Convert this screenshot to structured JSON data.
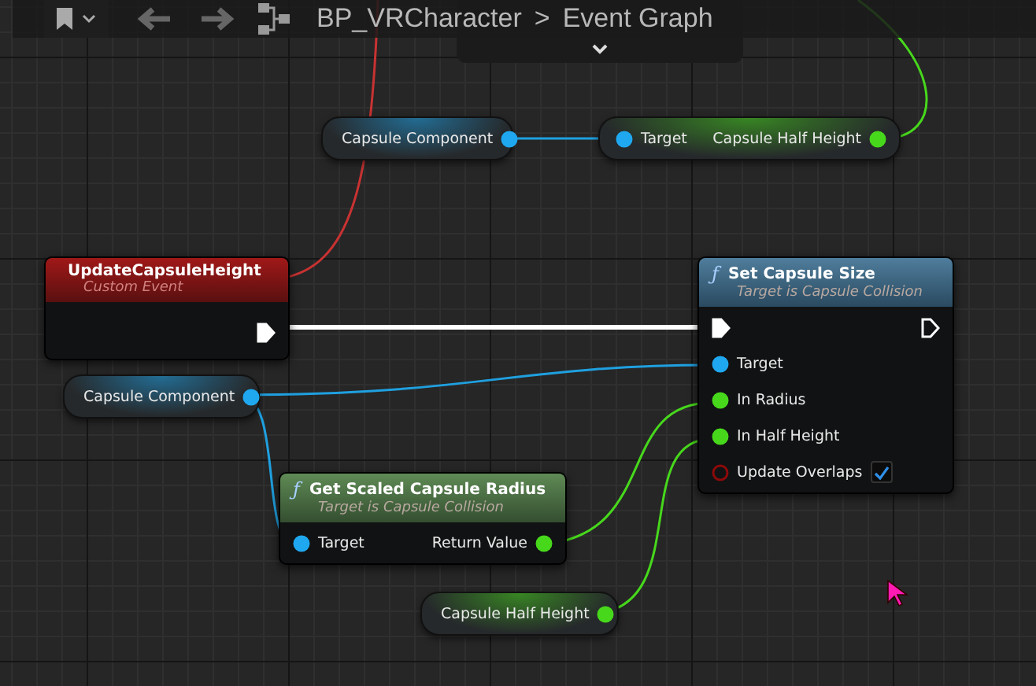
{
  "toolbar": {
    "breadcrumb": [
      "BP_VRCharacter",
      "Event Graph"
    ],
    "separator": ">"
  },
  "nodes": [
    {
      "kind": "variable",
      "title": "Capsule Component",
      "pin": {
        "kind": "object",
        "connected": true
      }
    },
    {
      "kind": "compact",
      "inputs": [
        {
          "kind": "object",
          "label": "Target",
          "connected": true
        }
      ],
      "outputs": [
        {
          "kind": "float",
          "label": "Capsule Half Height",
          "connected": true
        }
      ]
    },
    {
      "kind": "event",
      "title": "UpdateCapsuleHeight",
      "subtitle": "Custom Event",
      "outputs": [
        {
          "kind": "exec",
          "connected": true
        }
      ]
    },
    {
      "kind": "function",
      "icon": "ƒ",
      "title": "Set Capsule Size",
      "subtitle": "Target is Capsule Collision",
      "inputs": [
        {
          "kind": "exec",
          "connected": true
        },
        {
          "kind": "object",
          "label": "Target",
          "connected": true
        },
        {
          "kind": "float",
          "label": "In Radius",
          "connected": true
        },
        {
          "kind": "float",
          "label": "In Half Height",
          "connected": true
        },
        {
          "kind": "bool",
          "label": "Update Overlaps",
          "connected": false,
          "checked": true
        }
      ],
      "outputs": [
        {
          "kind": "exec",
          "connected": false
        }
      ]
    },
    {
      "kind": "variable",
      "title": "Capsule Component",
      "pin": {
        "kind": "object",
        "connected": true
      }
    },
    {
      "kind": "pure",
      "icon": "ƒ",
      "title": "Get Scaled Capsule Radius",
      "subtitle": "Target is Capsule Collision",
      "inputs": [
        {
          "kind": "object",
          "label": "Target",
          "connected": true
        }
      ],
      "outputs": [
        {
          "kind": "float",
          "label": "Return Value",
          "connected": true
        }
      ]
    },
    {
      "kind": "variable",
      "title": "Capsule Half Height",
      "pin": {
        "kind": "float",
        "connected": true
      }
    }
  ]
}
